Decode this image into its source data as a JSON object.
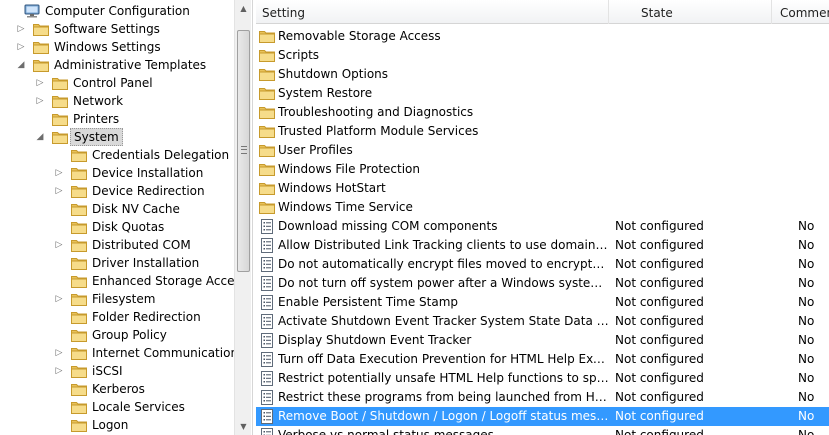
{
  "tree": {
    "items": [
      {
        "label": "Computer Configuration",
        "level": 0,
        "expander": "none",
        "icon": "computer-icon"
      },
      {
        "label": "Software Settings",
        "level": 1,
        "expander": "collapsed",
        "icon": "folder-icon"
      },
      {
        "label": "Windows Settings",
        "level": 1,
        "expander": "collapsed",
        "icon": "folder-icon"
      },
      {
        "label": "Administrative Templates",
        "level": 1,
        "expander": "expanded",
        "icon": "folder-icon"
      },
      {
        "label": "Control Panel",
        "level": 2,
        "expander": "collapsed",
        "icon": "folder-icon"
      },
      {
        "label": "Network",
        "level": 2,
        "expander": "collapsed",
        "icon": "folder-icon"
      },
      {
        "label": "Printers",
        "level": 2,
        "expander": "none",
        "icon": "folder-icon"
      },
      {
        "label": "System",
        "level": 2,
        "expander": "expanded",
        "icon": "folder-icon",
        "selected": true
      },
      {
        "label": "Credentials Delegation",
        "level": 3,
        "expander": "none",
        "icon": "folder-icon"
      },
      {
        "label": "Device Installation",
        "level": 3,
        "expander": "collapsed",
        "icon": "folder-icon"
      },
      {
        "label": "Device Redirection",
        "level": 3,
        "expander": "collapsed",
        "icon": "folder-icon"
      },
      {
        "label": "Disk NV Cache",
        "level": 3,
        "expander": "none",
        "icon": "folder-icon"
      },
      {
        "label": "Disk Quotas",
        "level": 3,
        "expander": "none",
        "icon": "folder-icon"
      },
      {
        "label": "Distributed COM",
        "level": 3,
        "expander": "collapsed",
        "icon": "folder-icon"
      },
      {
        "label": "Driver Installation",
        "level": 3,
        "expander": "none",
        "icon": "folder-icon"
      },
      {
        "label": "Enhanced Storage Access",
        "level": 3,
        "expander": "none",
        "icon": "folder-icon"
      },
      {
        "label": "Filesystem",
        "level": 3,
        "expander": "collapsed",
        "icon": "folder-icon"
      },
      {
        "label": "Folder Redirection",
        "level": 3,
        "expander": "none",
        "icon": "folder-icon"
      },
      {
        "label": "Group Policy",
        "level": 3,
        "expander": "none",
        "icon": "folder-icon"
      },
      {
        "label": "Internet Communication",
        "level": 3,
        "expander": "collapsed",
        "icon": "folder-icon"
      },
      {
        "label": "iSCSI",
        "level": 3,
        "expander": "collapsed",
        "icon": "folder-icon"
      },
      {
        "label": "Kerberos",
        "level": 3,
        "expander": "none",
        "icon": "folder-icon"
      },
      {
        "label": "Locale Services",
        "level": 3,
        "expander": "none",
        "icon": "folder-icon"
      },
      {
        "label": "Logon",
        "level": 3,
        "expander": "none",
        "icon": "folder-icon"
      }
    ]
  },
  "list": {
    "columns": {
      "setting": "Setting",
      "state": "State",
      "comment": "Commen"
    },
    "rows": [
      {
        "name": "Removable Storage Access",
        "type": "folder",
        "state": "",
        "comment": ""
      },
      {
        "name": "Scripts",
        "type": "folder",
        "state": "",
        "comment": ""
      },
      {
        "name": "Shutdown Options",
        "type": "folder",
        "state": "",
        "comment": ""
      },
      {
        "name": "System Restore",
        "type": "folder",
        "state": "",
        "comment": ""
      },
      {
        "name": "Troubleshooting and Diagnostics",
        "type": "folder",
        "state": "",
        "comment": ""
      },
      {
        "name": "Trusted Platform Module Services",
        "type": "folder",
        "state": "",
        "comment": ""
      },
      {
        "name": "User Profiles",
        "type": "folder",
        "state": "",
        "comment": ""
      },
      {
        "name": "Windows File Protection",
        "type": "folder",
        "state": "",
        "comment": ""
      },
      {
        "name": "Windows HotStart",
        "type": "folder",
        "state": "",
        "comment": ""
      },
      {
        "name": "Windows Time Service",
        "type": "folder",
        "state": "",
        "comment": ""
      },
      {
        "name": "Download missing COM components",
        "type": "policy",
        "state": "Not configured",
        "comment": "No"
      },
      {
        "name": "Allow Distributed Link Tracking clients to use domain resour...",
        "type": "policy",
        "state": "Not configured",
        "comment": "No"
      },
      {
        "name": "Do not automatically encrypt files moved to encrypted fold...",
        "type": "policy",
        "state": "Not configured",
        "comment": "No"
      },
      {
        "name": "Do not turn off system power after a Windows system shutd...",
        "type": "policy",
        "state": "Not configured",
        "comment": "No"
      },
      {
        "name": "Enable Persistent Time Stamp",
        "type": "policy",
        "state": "Not configured",
        "comment": "No"
      },
      {
        "name": "Activate Shutdown Event Tracker System State Data feature",
        "type": "policy",
        "state": "Not configured",
        "comment": "No"
      },
      {
        "name": "Display Shutdown Event Tracker",
        "type": "policy",
        "state": "Not configured",
        "comment": "No"
      },
      {
        "name": "Turn off Data Execution Prevention for HTML Help Executible",
        "type": "policy",
        "state": "Not configured",
        "comment": "No"
      },
      {
        "name": "Restrict potentially unsafe HTML Help functions to specified...",
        "type": "policy",
        "state": "Not configured",
        "comment": "No"
      },
      {
        "name": "Restrict these programs from being launched from Help",
        "type": "policy",
        "state": "Not configured",
        "comment": "No"
      },
      {
        "name": "Remove Boot / Shutdown / Logon / Logoff status messages",
        "type": "policy",
        "state": "Not configured",
        "comment": "No",
        "selected": true
      },
      {
        "name": "Verbose vs normal status messages",
        "type": "policy",
        "state": "Not configured",
        "comment": "No"
      }
    ]
  },
  "colors": {
    "selection": "#3399ff",
    "folder": "#f3d57a",
    "tree_selection": "#d9d9d9"
  }
}
